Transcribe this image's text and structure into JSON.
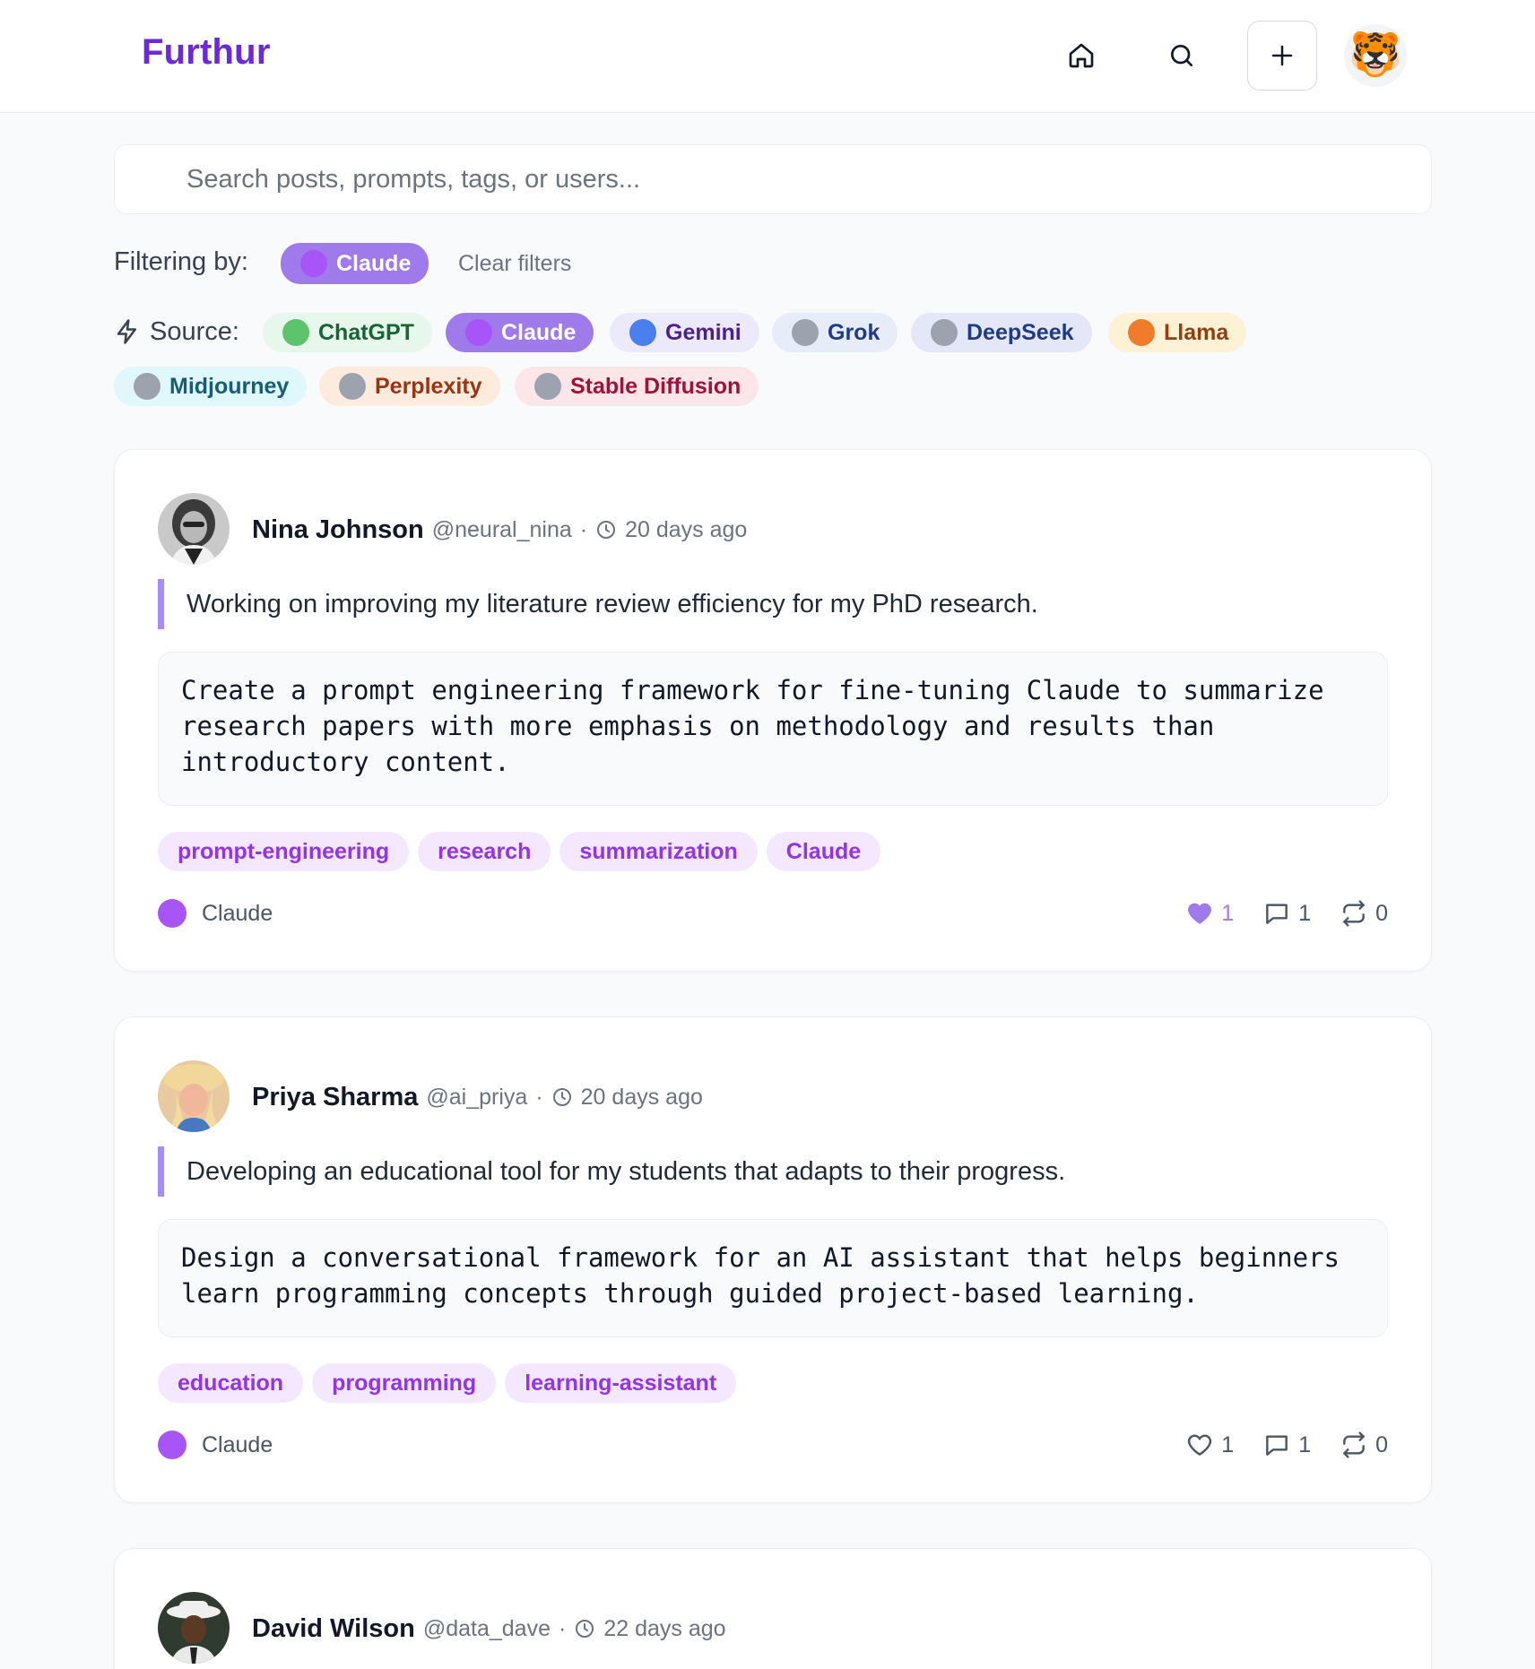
{
  "app": {
    "logo": "Furthur",
    "avatar_emoji": "🐯"
  },
  "search": {
    "placeholder": "Search posts, prompts, tags, or users..."
  },
  "filters": {
    "label": "Filtering by:",
    "active": "Claude",
    "clear_label": "Clear filters",
    "source_label": "Source:",
    "sources": [
      {
        "label": "ChatGPT",
        "dot": "#5cc46c",
        "bg": "#e8f7eb",
        "fg": "#166534",
        "active": false
      },
      {
        "label": "Claude",
        "dot": "#a855f7",
        "bg": "#9f7aea",
        "fg": "#ffffff",
        "active": true
      },
      {
        "label": "Gemini",
        "dot": "#4a7ff0",
        "bg": "#ece9fb",
        "fg": "#4c1d95",
        "active": false
      },
      {
        "label": "Grok",
        "dot": "#9ca3af",
        "bg": "#e6ecf8",
        "fg": "#1e3a8a",
        "active": false
      },
      {
        "label": "DeepSeek",
        "dot": "#9ca3af",
        "bg": "#e3e7f7",
        "fg": "#1e3a8a",
        "active": false
      },
      {
        "label": "Llama",
        "dot": "#f07b2a",
        "bg": "#fdf1d6",
        "fg": "#92400e",
        "active": false
      },
      {
        "label": "Midjourney",
        "dot": "#9ca3af",
        "bg": "#e0f7fb",
        "fg": "#155e75",
        "active": false
      },
      {
        "label": "Perplexity",
        "dot": "#9ca3af",
        "bg": "#fdebdd",
        "fg": "#9a3412",
        "active": false
      },
      {
        "label": "Stable Diffusion",
        "dot": "#9ca3af",
        "bg": "#fde6ea",
        "fg": "#9f1239",
        "active": false
      }
    ]
  },
  "posts": [
    {
      "name": "Nina Johnson",
      "handle": "@neural_nina",
      "separator": "·",
      "time": "20 days ago",
      "context": "Working on improving my literature review efficiency for my PhD research.",
      "prompt": "Create a prompt engineering framework for fine-tuning Claude to summarize\nresearch papers with more emphasis on methodology and results than\nintroductory content.",
      "tags": [
        "prompt-engineering",
        "research",
        "summarization",
        "Claude"
      ],
      "model": "Claude",
      "likes": "1",
      "comments": "1",
      "reposts": "0",
      "liked": true
    },
    {
      "name": "Priya Sharma",
      "handle": "@ai_priya",
      "separator": "·",
      "time": "20 days ago",
      "context": "Developing an educational tool for my students that adapts to their progress.",
      "prompt": "Design a conversational framework for an AI assistant that helps beginners\nlearn programming concepts through guided project-based learning.",
      "tags": [
        "education",
        "programming",
        "learning-assistant"
      ],
      "model": "Claude",
      "likes": "1",
      "comments": "1",
      "reposts": "0",
      "liked": false
    },
    {
      "name": "David Wilson",
      "handle": "@data_dave",
      "separator": "·",
      "time": "22 days ago"
    }
  ],
  "colors": {
    "brand": "#6d28d9",
    "accent": "#9f7aea",
    "tag_bg": "#f3e8ff",
    "tag_fg": "#9333ea"
  }
}
